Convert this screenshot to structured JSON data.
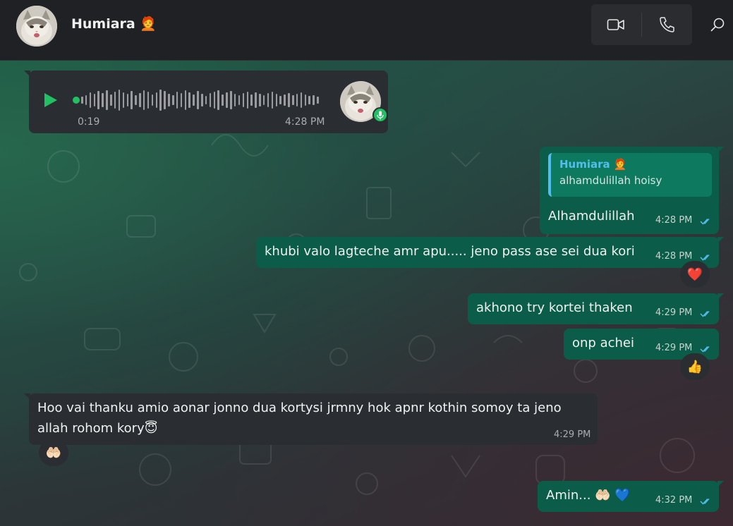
{
  "header": {
    "contact_name": "Humiara",
    "contact_emoji": "🧑‍🦰",
    "video_call_icon": "video-camera-icon",
    "voice_call_icon": "phone-icon",
    "search_icon": "search-icon"
  },
  "colors": {
    "incoming_bubble": "#2a2d31",
    "outgoing_bubble": "#0b5c48",
    "accent_green": "#21c063",
    "read_ticks": "#53bdeb"
  },
  "voice_note": {
    "duration": "0:19",
    "time": "4:28 PM",
    "play_icon": "play-icon",
    "mic_icon": "microphone-icon"
  },
  "messages": [
    {
      "quoted_name": "Humiara",
      "quoted_emoji": "🧑‍🦰",
      "quoted_text": "alhamdulillah hoisy",
      "text": "Alhamdulillah",
      "time": "4:28 PM"
    },
    {
      "text": "khubi valo lagteche amr apu..... jeno pass ase sei dua kori",
      "time": "4:28 PM",
      "reaction": "❤️"
    },
    {
      "text": "akhono try kortei thaken",
      "time": "4:29 PM"
    },
    {
      "text": "onp achei",
      "time": "4:29 PM",
      "reaction": "👍"
    },
    {
      "text_line1": "Hoo vai thanku amio aonar jonno dua kortysi jrmny hok apnr kothin somoy ta jeno",
      "text_line2": "allah rohom kory😇",
      "time": "4:29 PM",
      "reaction": "🤲🏻"
    },
    {
      "text": "Amin... 🤲🏻 💙",
      "time": "4:32 PM"
    }
  ]
}
